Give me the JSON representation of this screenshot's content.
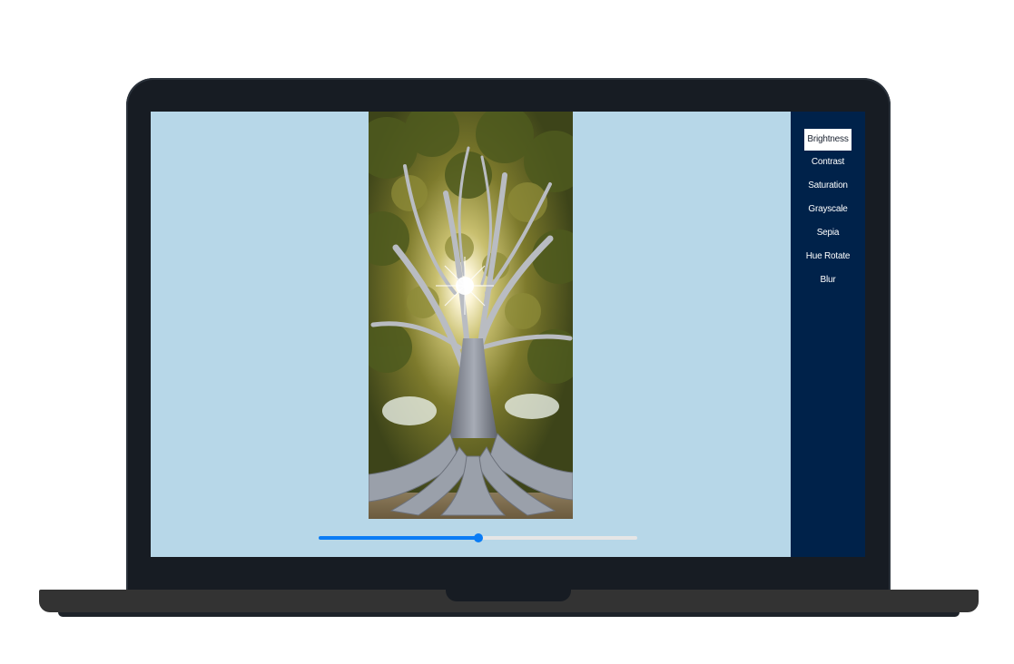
{
  "menu": {
    "items": [
      {
        "label": "Brightness",
        "active": true
      },
      {
        "label": "Contrast",
        "active": false
      },
      {
        "label": "Saturation",
        "active": false
      },
      {
        "label": "Grayscale",
        "active": false
      },
      {
        "label": "Sepia",
        "active": false
      },
      {
        "label": "Hue Rotate",
        "active": false
      },
      {
        "label": "Blur",
        "active": false
      }
    ]
  },
  "slider": {
    "value_fraction": 0.5
  },
  "image": {
    "subject": "tree-photo"
  },
  "colors": {
    "screen_background": "#b7d7e8",
    "sidebar_background": "#00224a",
    "slider_accent": "#0a7cf5",
    "bezel": "#171c23"
  }
}
